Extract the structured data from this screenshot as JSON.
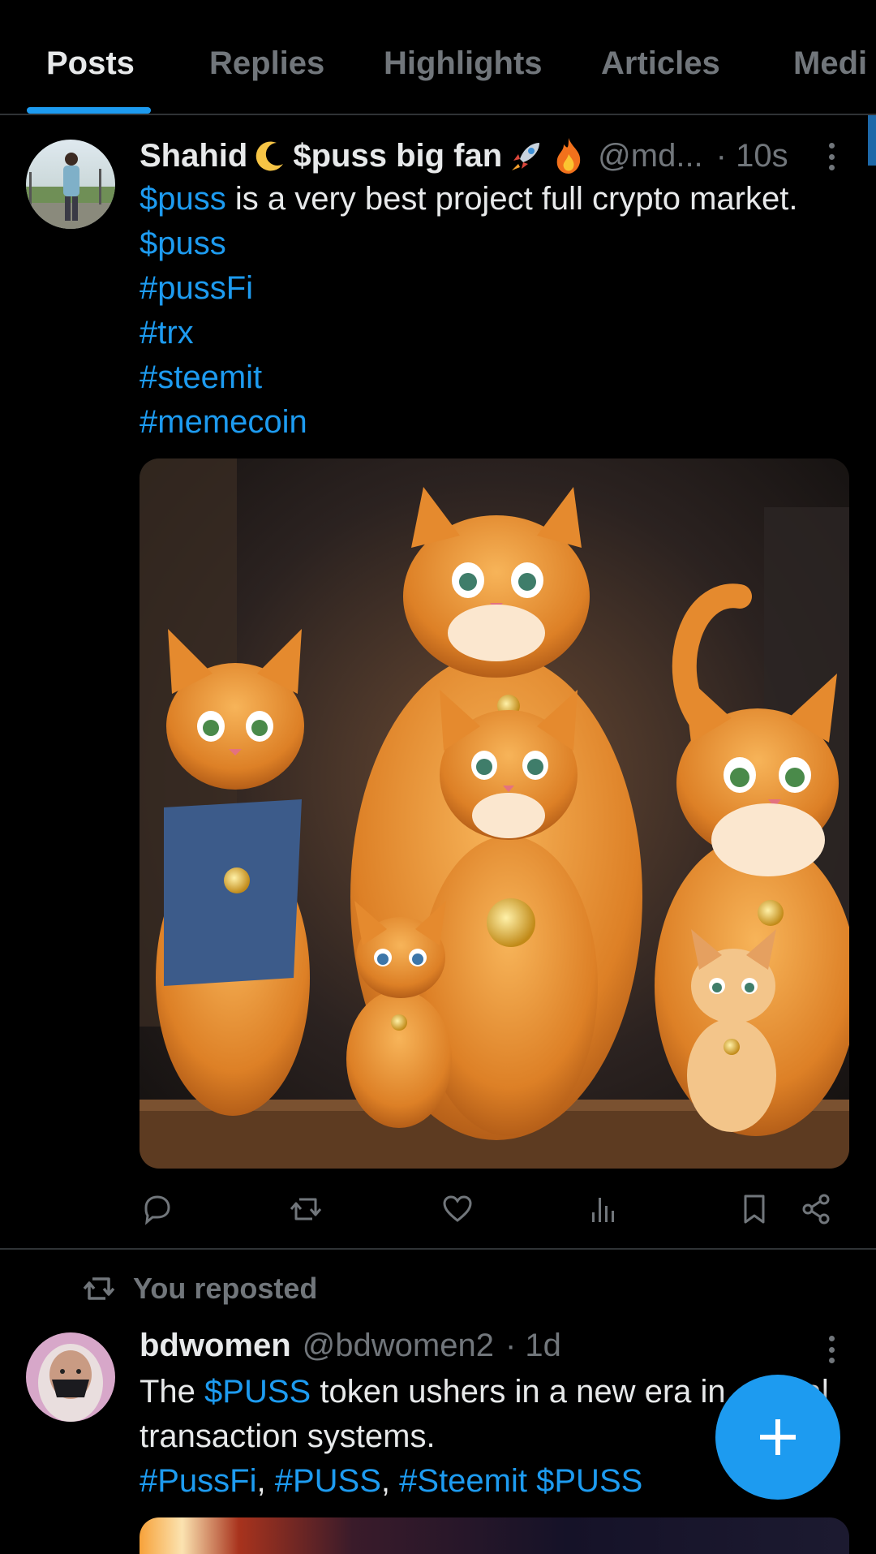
{
  "tabs": [
    {
      "label": "Posts",
      "active": true
    },
    {
      "label": "Replies"
    },
    {
      "label": "Highlights"
    },
    {
      "label": "Articles"
    },
    {
      "label": "Medi"
    }
  ],
  "post1": {
    "author_name": "Shahid",
    "author_name_suffix": "$puss big fan",
    "handle": "@md...",
    "time": "· 10s",
    "text_link": "$puss",
    "text_rest": " is a very best project full crypto market.",
    "tags": [
      "$puss",
      "#pussFi",
      "#trx",
      "#steemit",
      "#memecoin"
    ],
    "media_description": "cartoon orange cats wearing gold coin necklaces"
  },
  "repost_banner": "You reposted",
  "post2": {
    "author_name": "bdwomen",
    "handle": "@bdwomen2",
    "time": "· 1d",
    "text_before": "The ",
    "text_link": "$PUSS",
    "text_after_line1": " token ushers in a new era in",
    "text_line1_tail": "al",
    "text_line2": "transaction systems.",
    "tags": [
      "#PussFi",
      "#PUSS",
      "#Steemit",
      "$PUSS"
    ]
  },
  "colors": {
    "accent": "#1d9bf0",
    "background": "#000000",
    "muted": "#71767b",
    "text": "#e7e9ea"
  }
}
